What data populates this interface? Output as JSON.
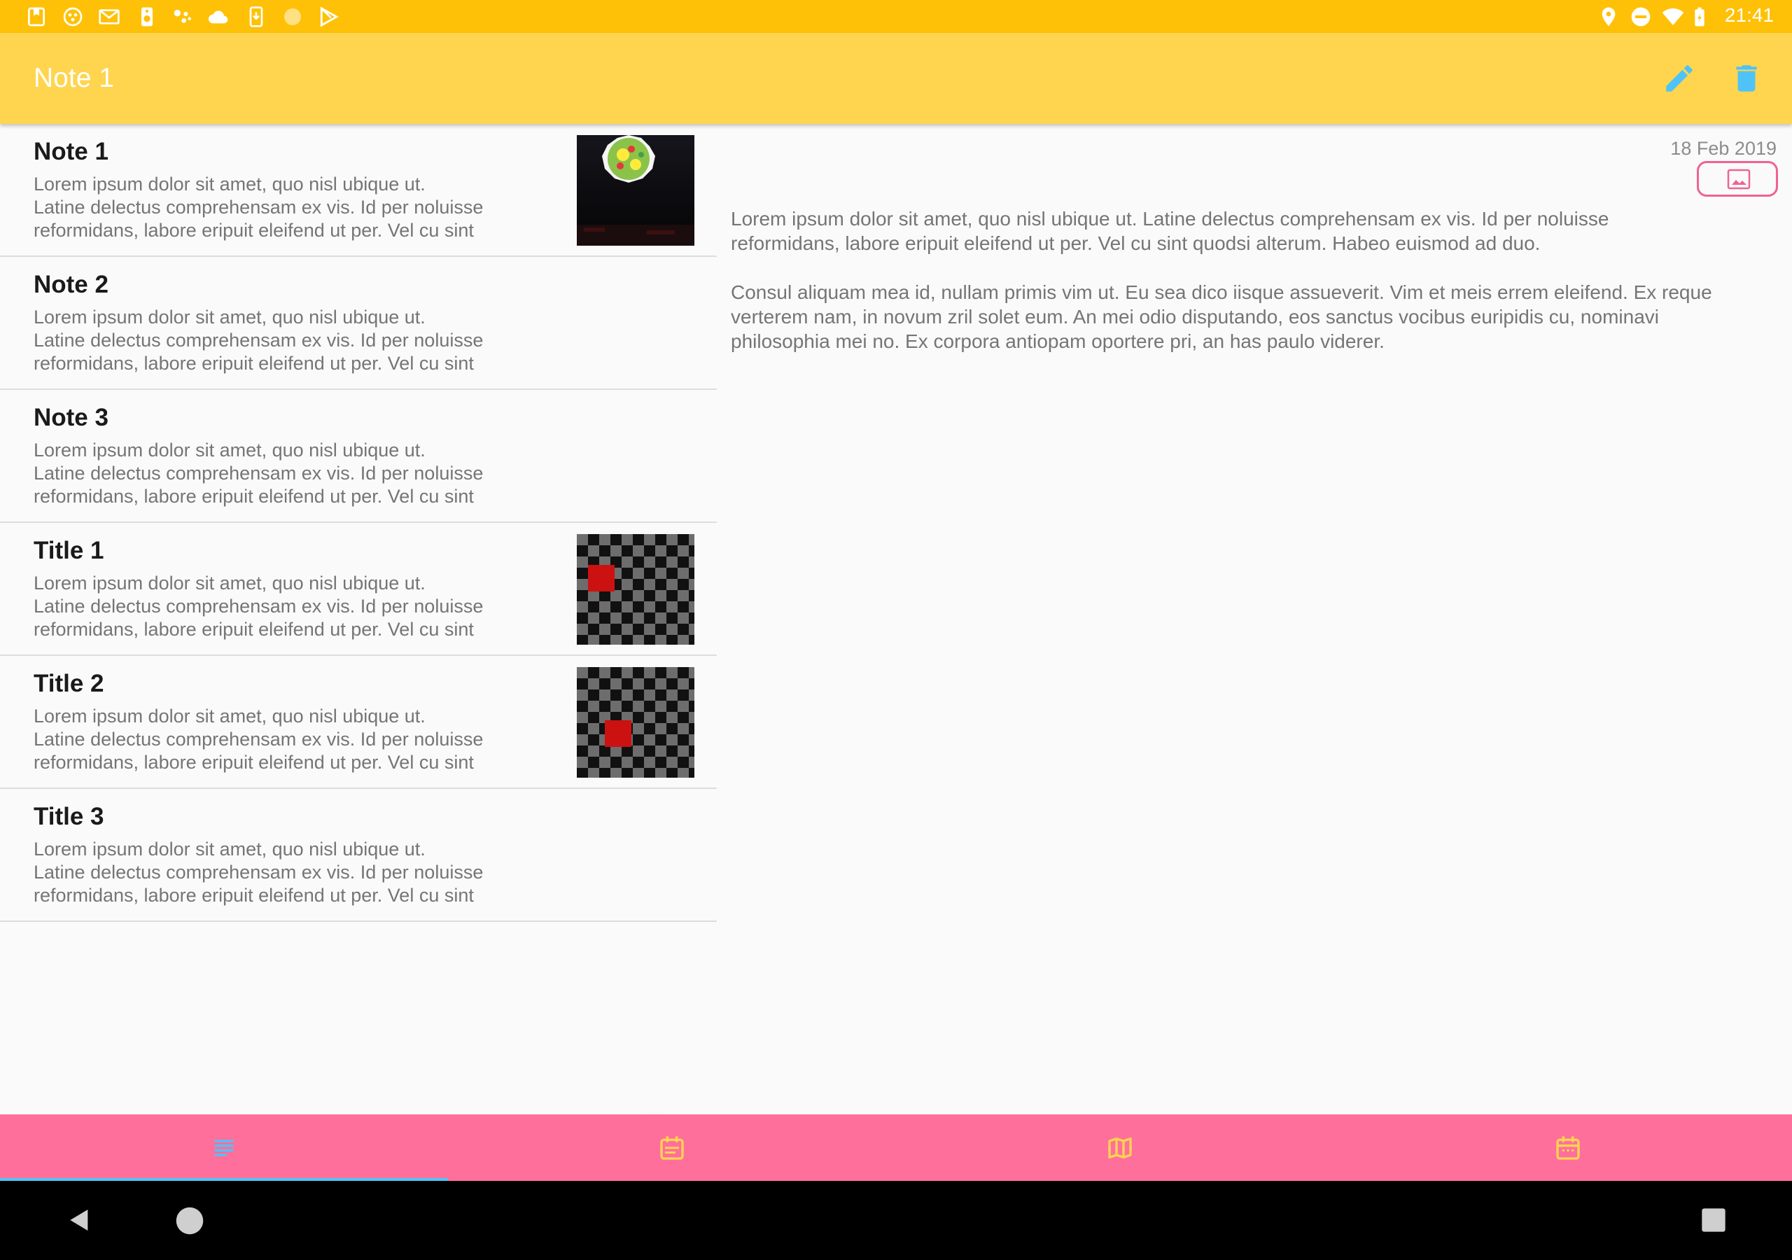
{
  "status_bar": {
    "time": "21:41",
    "left_icons": [
      "bookmark-icon",
      "badge-icon",
      "gmail-icon",
      "speaker-icon",
      "assistant-icon",
      "cloud-icon",
      "phone-icon",
      "circle-icon",
      "play-store-icon"
    ],
    "right_icons": [
      "location-icon",
      "dnd-icon",
      "wifi-icon",
      "battery-icon"
    ]
  },
  "app_bar": {
    "title": "Note 1",
    "actions": [
      "edit-icon",
      "delete-icon"
    ]
  },
  "notes": [
    {
      "title": "Note 1",
      "line1": "Lorem ipsum dolor sit amet, quo nisl ubique ut.",
      "line2": "Latine delectus comprehensam ex vis. Id per noluisse",
      "line3": "reformidans, labore eripuit eleifend ut per. Vel cu sint",
      "has_image": true
    },
    {
      "title": "Note 2",
      "line1": "Lorem ipsum dolor sit amet, quo nisl ubique ut.",
      "line2": "Latine delectus comprehensam ex vis. Id per noluisse",
      "line3": "reformidans, labore eripuit eleifend ut per. Vel cu sint",
      "has_image": false
    },
    {
      "title": "Note 3",
      "line1": "Lorem ipsum dolor sit amet, quo nisl ubique ut.",
      "line2": "Latine delectus comprehensam ex vis. Id per noluisse",
      "line3": "reformidans, labore eripuit eleifend ut per. Vel cu sint",
      "has_image": false
    },
    {
      "title": "Title 1",
      "line1": "Lorem ipsum dolor sit amet, quo nisl ubique ut.",
      "line2": "Latine delectus comprehensam ex vis. Id per noluisse",
      "line3": "reformidans, labore eripuit eleifend ut per. Vel cu sint",
      "has_image": true
    },
    {
      "title": "Title 2",
      "line1": "Lorem ipsum dolor sit amet, quo nisl ubique ut.",
      "line2": "Latine delectus comprehensam ex vis. Id per noluisse",
      "line3": "reformidans, labore eripuit eleifend ut per. Vel cu sint",
      "has_image": true
    },
    {
      "title": "Title 3",
      "line1": "Lorem ipsum dolor sit amet, quo nisl ubique ut.",
      "line2": "Latine delectus comprehensam ex vis. Id per noluisse",
      "line3": "reformidans, labore eripuit eleifend ut per. Vel cu sint",
      "has_image": false
    }
  ],
  "fab": {
    "label": "+"
  },
  "detail": {
    "date": "18 Feb 2019",
    "paragraph1_line1": "Lorem ipsum dolor sit amet, quo nisl ubique ut. Latine delectus comprehensam ex vis. Id per noluisse",
    "paragraph1_line2": "reformidans, labore eripuit eleifend ut per. Vel cu sint quodsi alterum. Habeo euismod ad duo.",
    "paragraph2_line1": "Consul aliquam mea id, nullam primis vim ut. Eu sea dico iisque assueverit. Vim et meis errem eleifend. Ex reque",
    "paragraph2_line2": "verterem nam, in novum zril solet eum. An mei odio disputando, eos sanctus vocibus euripidis cu, nominavi",
    "paragraph2_line3": "philosophia mei no. Ex corpora antiopam oportere pri, an has paulo viderer."
  },
  "bottom_nav": {
    "tabs": [
      "notes-list-icon",
      "calendar-note-icon",
      "map-icon",
      "calendar-icon"
    ],
    "selected_index": 0
  },
  "colors": {
    "status_bar": "#ffc107",
    "app_bar": "#ffd54f",
    "accent_blue": "#4fc3f7",
    "bottom_nav": "#ff6f9c",
    "nav_icon": "#ffd54f"
  }
}
